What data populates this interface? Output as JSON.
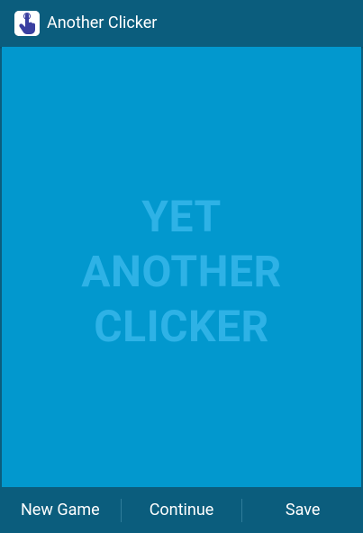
{
  "app": {
    "title": "Another Clicker",
    "icon": "pointing-hand-icon"
  },
  "game": {
    "title_lines": [
      "YET",
      "ANOTHER",
      "CLICKER"
    ]
  },
  "bottom_bar": {
    "new_game_label": "New Game",
    "continue_label": "Continue",
    "save_label": "Save"
  },
  "colors": {
    "bar": "#0b5d7d",
    "game_background": "#0298ce",
    "title_text": "#2eb2e6",
    "label_text": "#ffffff"
  }
}
